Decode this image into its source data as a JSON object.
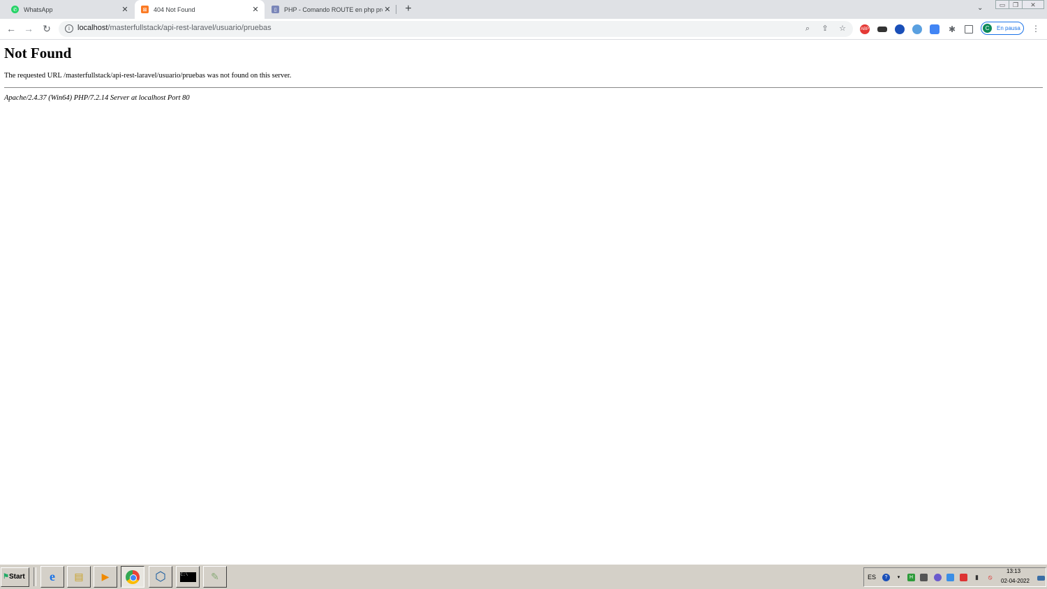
{
  "browser": {
    "tabs": [
      {
        "label": "WhatsApp",
        "icon": "whatsapp-icon",
        "color": "#25d366"
      },
      {
        "label": "404 Not Found",
        "icon": "xampp-icon",
        "color": "#fb7a24"
      },
      {
        "label": "PHP - Comando ROUTE en php prof",
        "icon": "php-icon",
        "color": "#7a86b8"
      }
    ],
    "new_tab": "+",
    "tab_list": "⌄",
    "address": {
      "host": "localhost",
      "path": "/masterfullstack/api-rest-laravel/usuario/pruebas"
    },
    "profile": {
      "initial": "C",
      "label": "En pausa"
    },
    "extensions": [
      {
        "name": "adblock-plus-icon",
        "text": "ABP",
        "color": "#e53935"
      },
      {
        "name": "extension-card-icon",
        "text": "",
        "color": "#333333"
      },
      {
        "name": "extension-user-icon",
        "text": "",
        "color": "#1a4fb8"
      },
      {
        "name": "extension-globe-icon",
        "text": "",
        "color": "#5aa0e0"
      },
      {
        "name": "google-translate-icon",
        "text": "",
        "color": "#4285f4"
      }
    ]
  },
  "page": {
    "heading": "Not Found",
    "message": "The requested URL /masterfullstack/api-rest-laravel/usuario/pruebas was not found on this server.",
    "signature": "Apache/2.4.37 (Win64) PHP/7.2.14 Server at localhost Port 80"
  },
  "taskbar": {
    "start_label": "Start",
    "apps": [
      {
        "name": "internet-explorer-icon",
        "glyph": "e"
      },
      {
        "name": "file-explorer-icon",
        "glyph": "▤"
      },
      {
        "name": "media-player-icon",
        "glyph": "▶"
      },
      {
        "name": "chrome-icon",
        "glyph": "◉"
      },
      {
        "name": "virtualbox-icon",
        "glyph": "⬡"
      },
      {
        "name": "command-prompt-icon",
        "glyph": "C:\\"
      },
      {
        "name": "paint-icon",
        "glyph": "✎"
      }
    ],
    "tray": {
      "language": "ES",
      "time": "13:13",
      "date": "02-04-2022"
    }
  }
}
